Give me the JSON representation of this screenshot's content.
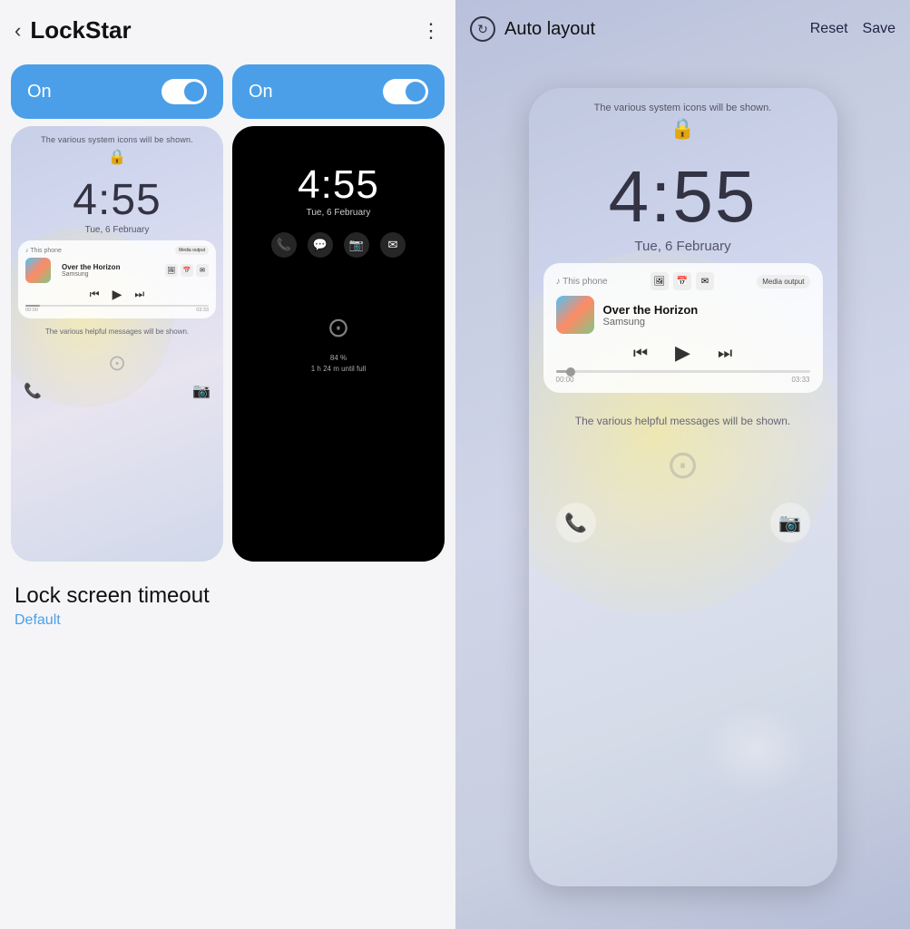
{
  "left": {
    "header": {
      "title": "LockStar",
      "back_label": "‹",
      "menu_label": "⋮"
    },
    "toggle1": {
      "label": "On",
      "state": "on"
    },
    "toggle2": {
      "label": "On",
      "state": "on"
    },
    "phone_light": {
      "top_hint": "The various system icons will be shown.",
      "time": "4:55",
      "date": "Tue, 6 February",
      "music": {
        "source": "♪ This phone",
        "title": "Over the Horizon",
        "artist": "Samsung",
        "media_output": "Media output",
        "time_start": "00:00",
        "time_end": "03:33"
      },
      "bottom_hint": "The various helpful messages will be shown."
    },
    "phone_dark": {
      "time": "4:55",
      "date": "Tue, 6 February",
      "battery_pct": "84 %",
      "battery_time": "1 h 24 m until full"
    },
    "timeout": {
      "title": "Lock screen timeout",
      "value": "Default"
    }
  },
  "right": {
    "header": {
      "icon_label": "↻",
      "title": "Auto layout",
      "reset_label": "Reset",
      "save_label": "Save"
    },
    "phone_large": {
      "top_hint": "The various system icons will be shown.",
      "time": "4:55",
      "date": "Tue, 6 February",
      "music": {
        "source": "♪ This phone",
        "title": "Over the Horizon",
        "artist": "Samsung",
        "media_output": "Media output",
        "time_start": "00:00",
        "time_end": "03:33"
      },
      "bottom_hint": "The various helpful messages will be shown."
    }
  }
}
